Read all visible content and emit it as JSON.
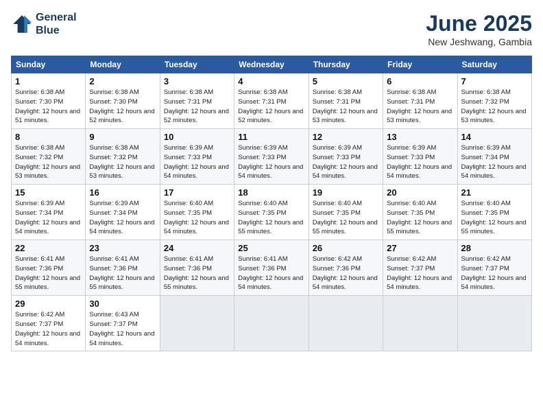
{
  "logo": {
    "line1": "General",
    "line2": "Blue"
  },
  "title": "June 2025",
  "subtitle": "New Jeshwang, Gambia",
  "headers": [
    "Sunday",
    "Monday",
    "Tuesday",
    "Wednesday",
    "Thursday",
    "Friday",
    "Saturday"
  ],
  "weeks": [
    [
      {
        "day": "1",
        "sunrise": "6:38 AM",
        "sunset": "7:30 PM",
        "daylight": "12 hours and 51 minutes."
      },
      {
        "day": "2",
        "sunrise": "6:38 AM",
        "sunset": "7:30 PM",
        "daylight": "12 hours and 52 minutes."
      },
      {
        "day": "3",
        "sunrise": "6:38 AM",
        "sunset": "7:31 PM",
        "daylight": "12 hours and 52 minutes."
      },
      {
        "day": "4",
        "sunrise": "6:38 AM",
        "sunset": "7:31 PM",
        "daylight": "12 hours and 52 minutes."
      },
      {
        "day": "5",
        "sunrise": "6:38 AM",
        "sunset": "7:31 PM",
        "daylight": "12 hours and 53 minutes."
      },
      {
        "day": "6",
        "sunrise": "6:38 AM",
        "sunset": "7:31 PM",
        "daylight": "12 hours and 53 minutes."
      },
      {
        "day": "7",
        "sunrise": "6:38 AM",
        "sunset": "7:32 PM",
        "daylight": "12 hours and 53 minutes."
      }
    ],
    [
      {
        "day": "8",
        "sunrise": "6:38 AM",
        "sunset": "7:32 PM",
        "daylight": "12 hours and 53 minutes."
      },
      {
        "day": "9",
        "sunrise": "6:38 AM",
        "sunset": "7:32 PM",
        "daylight": "12 hours and 53 minutes."
      },
      {
        "day": "10",
        "sunrise": "6:39 AM",
        "sunset": "7:33 PM",
        "daylight": "12 hours and 54 minutes."
      },
      {
        "day": "11",
        "sunrise": "6:39 AM",
        "sunset": "7:33 PM",
        "daylight": "12 hours and 54 minutes."
      },
      {
        "day": "12",
        "sunrise": "6:39 AM",
        "sunset": "7:33 PM",
        "daylight": "12 hours and 54 minutes."
      },
      {
        "day": "13",
        "sunrise": "6:39 AM",
        "sunset": "7:33 PM",
        "daylight": "12 hours and 54 minutes."
      },
      {
        "day": "14",
        "sunrise": "6:39 AM",
        "sunset": "7:34 PM",
        "daylight": "12 hours and 54 minutes."
      }
    ],
    [
      {
        "day": "15",
        "sunrise": "6:39 AM",
        "sunset": "7:34 PM",
        "daylight": "12 hours and 54 minutes."
      },
      {
        "day": "16",
        "sunrise": "6:39 AM",
        "sunset": "7:34 PM",
        "daylight": "12 hours and 54 minutes."
      },
      {
        "day": "17",
        "sunrise": "6:40 AM",
        "sunset": "7:35 PM",
        "daylight": "12 hours and 54 minutes."
      },
      {
        "day": "18",
        "sunrise": "6:40 AM",
        "sunset": "7:35 PM",
        "daylight": "12 hours and 55 minutes."
      },
      {
        "day": "19",
        "sunrise": "6:40 AM",
        "sunset": "7:35 PM",
        "daylight": "12 hours and 55 minutes."
      },
      {
        "day": "20",
        "sunrise": "6:40 AM",
        "sunset": "7:35 PM",
        "daylight": "12 hours and 55 minutes."
      },
      {
        "day": "21",
        "sunrise": "6:40 AM",
        "sunset": "7:35 PM",
        "daylight": "12 hours and 55 minutes."
      }
    ],
    [
      {
        "day": "22",
        "sunrise": "6:41 AM",
        "sunset": "7:36 PM",
        "daylight": "12 hours and 55 minutes."
      },
      {
        "day": "23",
        "sunrise": "6:41 AM",
        "sunset": "7:36 PM",
        "daylight": "12 hours and 55 minutes."
      },
      {
        "day": "24",
        "sunrise": "6:41 AM",
        "sunset": "7:36 PM",
        "daylight": "12 hours and 55 minutes."
      },
      {
        "day": "25",
        "sunrise": "6:41 AM",
        "sunset": "7:36 PM",
        "daylight": "12 hours and 54 minutes."
      },
      {
        "day": "26",
        "sunrise": "6:42 AM",
        "sunset": "7:36 PM",
        "daylight": "12 hours and 54 minutes."
      },
      {
        "day": "27",
        "sunrise": "6:42 AM",
        "sunset": "7:37 PM",
        "daylight": "12 hours and 54 minutes."
      },
      {
        "day": "28",
        "sunrise": "6:42 AM",
        "sunset": "7:37 PM",
        "daylight": "12 hours and 54 minutes."
      }
    ],
    [
      {
        "day": "29",
        "sunrise": "6:42 AM",
        "sunset": "7:37 PM",
        "daylight": "12 hours and 54 minutes."
      },
      {
        "day": "30",
        "sunrise": "6:43 AM",
        "sunset": "7:37 PM",
        "daylight": "12 hours and 54 minutes."
      },
      null,
      null,
      null,
      null,
      null
    ]
  ],
  "labels": {
    "sunrise": "Sunrise:",
    "sunset": "Sunset:",
    "daylight": "Daylight:"
  }
}
